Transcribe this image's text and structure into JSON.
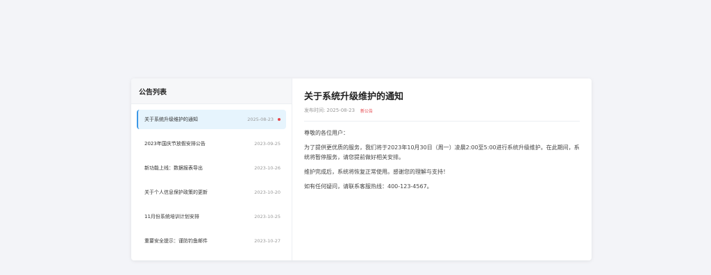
{
  "sidebar": {
    "title": "公告列表",
    "items": [
      {
        "title": "关于系统升级维护的通知",
        "date": "2025-08-23",
        "unread": true,
        "active": true
      },
      {
        "title": "2023年国庆节放假安排公告",
        "date": "2023-09-25",
        "unread": false,
        "active": false
      },
      {
        "title": "新功能上线：数据报表导出",
        "date": "2023-10-26",
        "unread": false,
        "active": false
      },
      {
        "title": "关于个人信息保护政策的更新",
        "date": "2023-10-20",
        "unread": false,
        "active": false
      },
      {
        "title": "11月份系统培训计划安排",
        "date": "2023-10-25",
        "unread": false,
        "active": false
      },
      {
        "title": "重要安全提示：谨防钓鱼邮件",
        "date": "2023-10-27",
        "unread": false,
        "active": false
      }
    ]
  },
  "detail": {
    "title": "关于系统升级维护的通知",
    "meta_label": "发布时间:",
    "meta_date": "2025-08-23",
    "badge": "新公告",
    "greeting": "尊敬的各位用户：",
    "paragraph1": "为了提供更优质的服务，我们将于2023年10月30日（周一）凌晨2:00至5:00进行系统升级维护。在此期间，系统将暂停服务，请您提前做好相关安排。",
    "paragraph2": "维护完成后，系统将恢复正常使用。感谢您的理解与支持！",
    "paragraph3": "如有任何疑问，请联系客服热线：400-123-4567。"
  },
  "colors": {
    "accent": "#3b97e6",
    "active_bg": "#e6f4fd",
    "unread_dot": "#e5454b"
  }
}
